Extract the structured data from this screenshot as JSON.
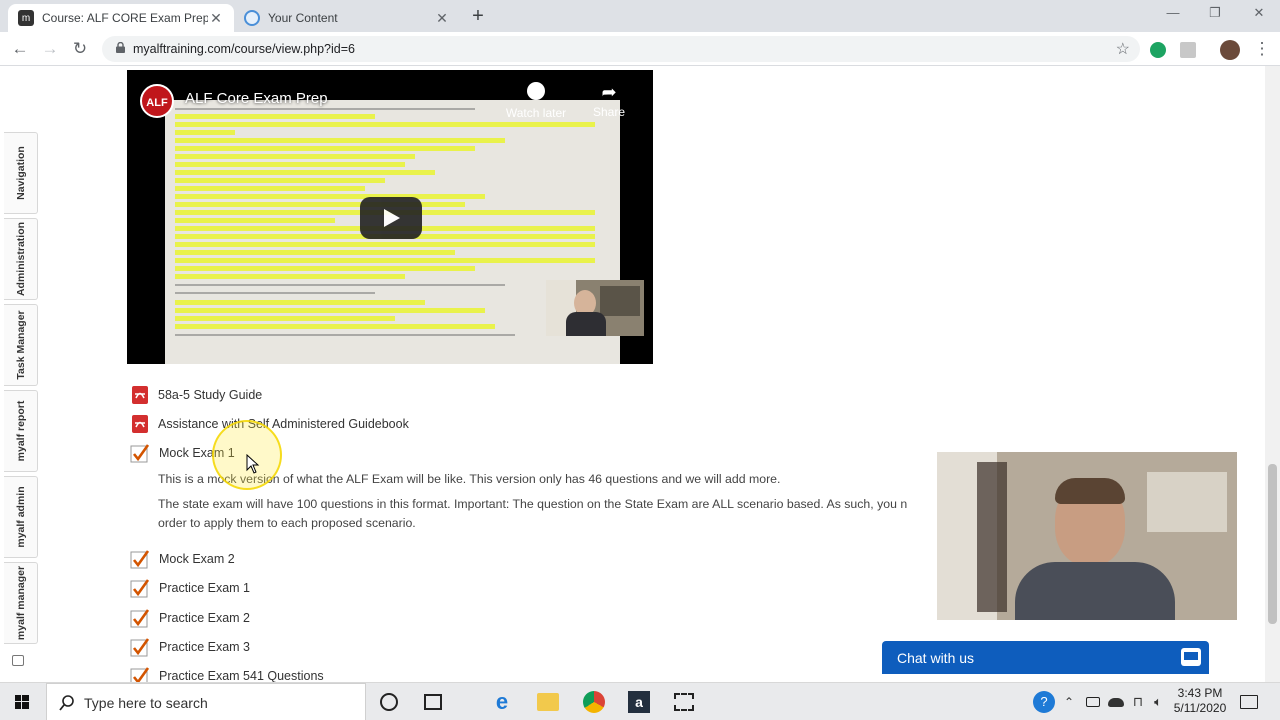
{
  "browser": {
    "tabs": [
      {
        "title": "Course: ALF CORE Exam Prep",
        "active": true,
        "favicon": "moodle-icon"
      },
      {
        "title": "Your Content",
        "active": false,
        "favicon": "globe-icon"
      }
    ],
    "new_tab": "+",
    "url": "myalftraining.com/course/view.php?id=6",
    "window_controls": {
      "minimize": "—",
      "maximize": "❐",
      "close": "✕"
    }
  },
  "sidebar_tabs": [
    "Navigation",
    "Administration",
    "Task Manager",
    "myalf report",
    "myalf admin",
    "myalf manager"
  ],
  "video": {
    "title": "ALF Core Exam Prep",
    "logo": "ALF",
    "watch_later": "Watch later",
    "share": "Share"
  },
  "activities": [
    {
      "type": "pdf",
      "label": "58a-5 Study Guide"
    },
    {
      "type": "pdf",
      "label": "Assistance with Self Administered Guidebook"
    },
    {
      "type": "quiz",
      "label": "Mock Exam 1"
    },
    {
      "type": "quiz",
      "label": "Mock Exam 2"
    },
    {
      "type": "quiz",
      "label": "Practice Exam 1"
    },
    {
      "type": "quiz",
      "label": "Practice Exam 2"
    },
    {
      "type": "quiz",
      "label": "Practice Exam 3"
    },
    {
      "type": "quiz",
      "label": "Practice Exam 541 Questions"
    }
  ],
  "mock_exam_description": {
    "line1": "This is a mock version of what the ALF Exam will be like. This version only has 46 questions and we will add more.",
    "line2": "The state exam will have 100 questions in this format.  Important: The question on the State Exam are ALL scenario based.  As such, you n",
    "line3": "order to apply them to each proposed scenario."
  },
  "chat": {
    "label": "Chat with us"
  },
  "taskbar": {
    "search_placeholder": "Type here to search",
    "time": "3:43 PM",
    "date": "5/11/2020"
  },
  "colors": {
    "chat_blue": "#0e5dbd",
    "pdf_red": "#d32f2f",
    "quiz_check": "#d35400",
    "highlight_yellow": "#e9f33b"
  }
}
